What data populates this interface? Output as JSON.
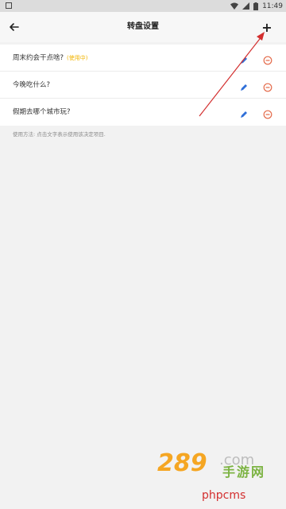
{
  "status_bar": {
    "time": "11:49",
    "icons": [
      "notification-icon",
      "wifi-icon",
      "signal-icon",
      "battery-icon"
    ]
  },
  "app_bar": {
    "title": "转盘设置",
    "back_icon": "back-arrow-icon",
    "add_icon": "plus-icon",
    "add_label": "+"
  },
  "items": [
    {
      "title": "周末约会干点啥?",
      "badge": "(使用中)"
    },
    {
      "title": "今晚吃什么?",
      "badge": ""
    },
    {
      "title": "假期去哪个城市玩?",
      "badge": ""
    }
  ],
  "item_icons": {
    "edit": "pencil-icon",
    "delete": "remove-circle-icon"
  },
  "hint": "使用方法: 点击文字表示使用该决定项目.",
  "watermark": {
    "logo": "289.com",
    "cn": "手游网",
    "text": "phpcms"
  },
  "colors": {
    "accent_blue": "#2f6fd8",
    "delete_red": "#e46a4a",
    "badge_yellow": "#f2b400",
    "annotation_arrow": "#d32f2f",
    "watermark_orange": "#f5a623",
    "watermark_green": "#7cb342",
    "watermark_red": "#d32f2f"
  }
}
